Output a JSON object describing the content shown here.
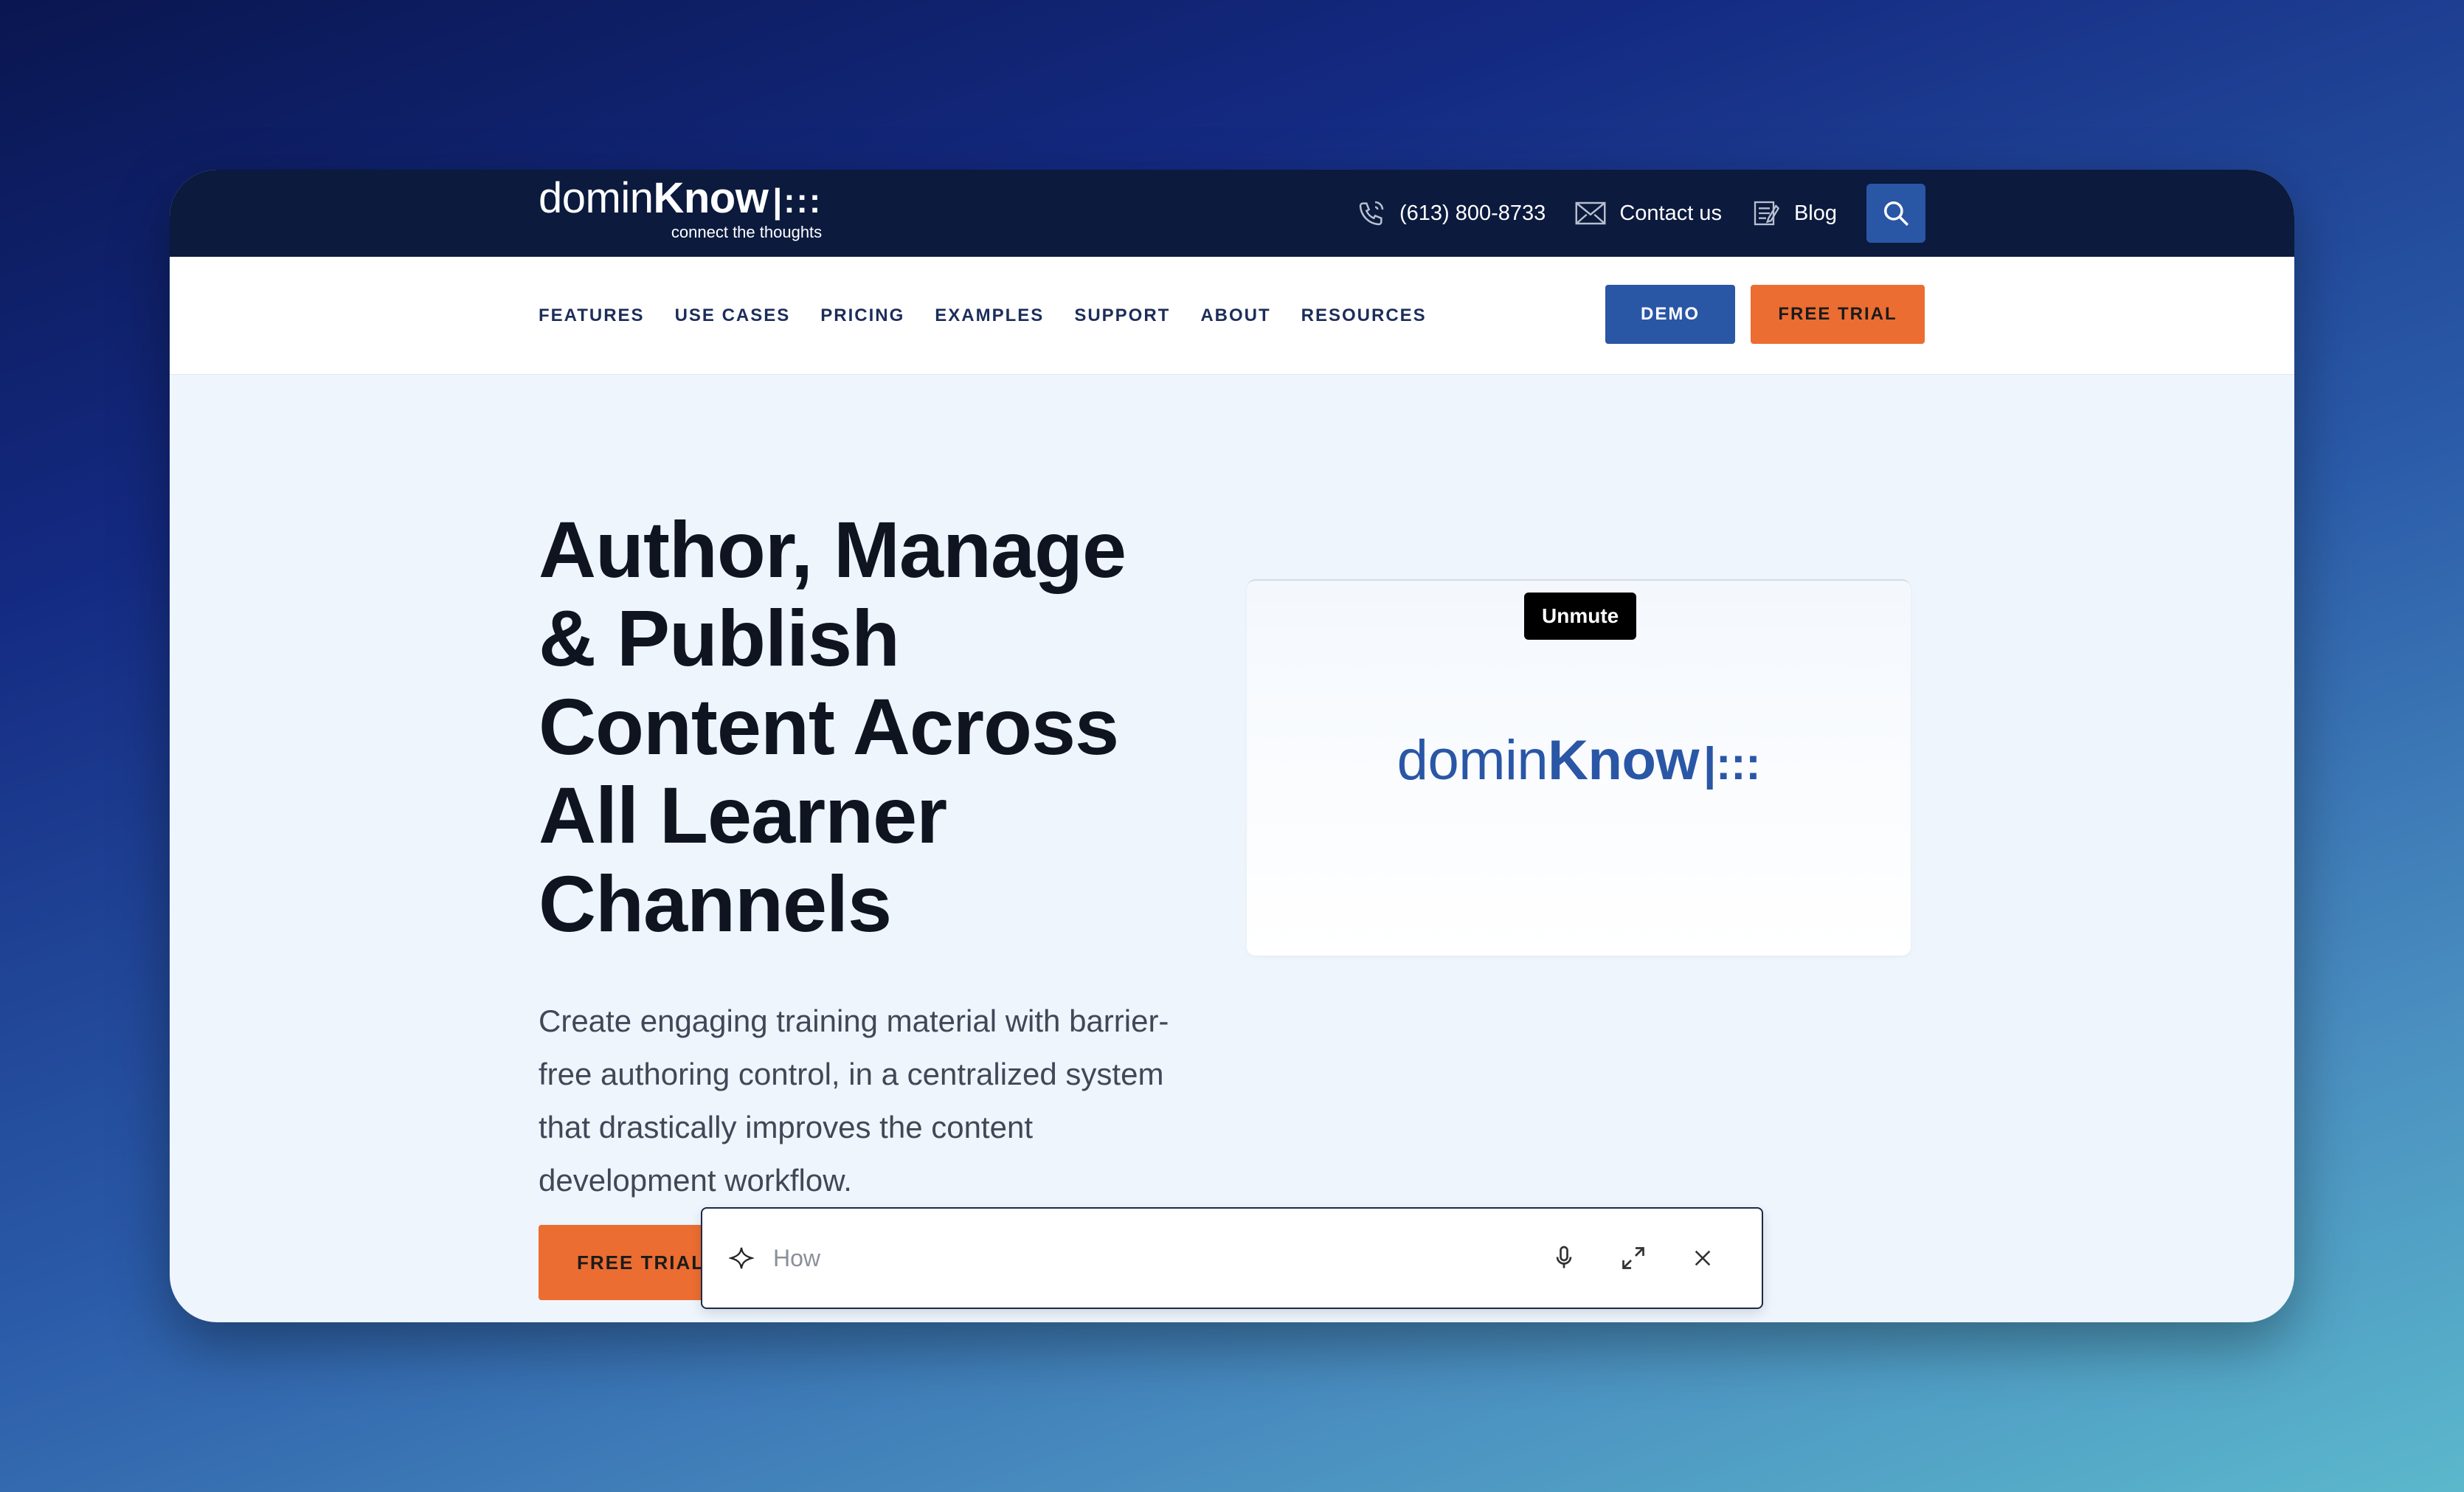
{
  "header": {
    "logo": {
      "light": "domin",
      "bold": "Know",
      "dots": "|:::",
      "tagline": "connect the thoughts"
    },
    "phone": "(613) 800-8733",
    "contact": "Contact us",
    "blog": "Blog"
  },
  "nav": {
    "items": [
      "FEATURES",
      "USE CASES",
      "PRICING",
      "EXAMPLES",
      "SUPPORT",
      "ABOUT",
      "RESOURCES"
    ],
    "demo": "DEMO",
    "free_trial": "FREE TRIAL"
  },
  "hero": {
    "title": "Author, Manage & Publish Content Across All Learner Channels",
    "text": "Create engaging training material with barrier-free authoring control, in a centralized system that drastically improves the content development workflow.",
    "cta": "FREE TRIAL"
  },
  "video": {
    "unmute": "Unmute",
    "logo_light": "domin",
    "logo_bold": "Know",
    "logo_dots": "|:::"
  },
  "assistant": {
    "placeholder": "How"
  },
  "colors": {
    "navy": "#0b1a3d",
    "blue": "#2a56a6",
    "orange": "#ec6d31"
  }
}
